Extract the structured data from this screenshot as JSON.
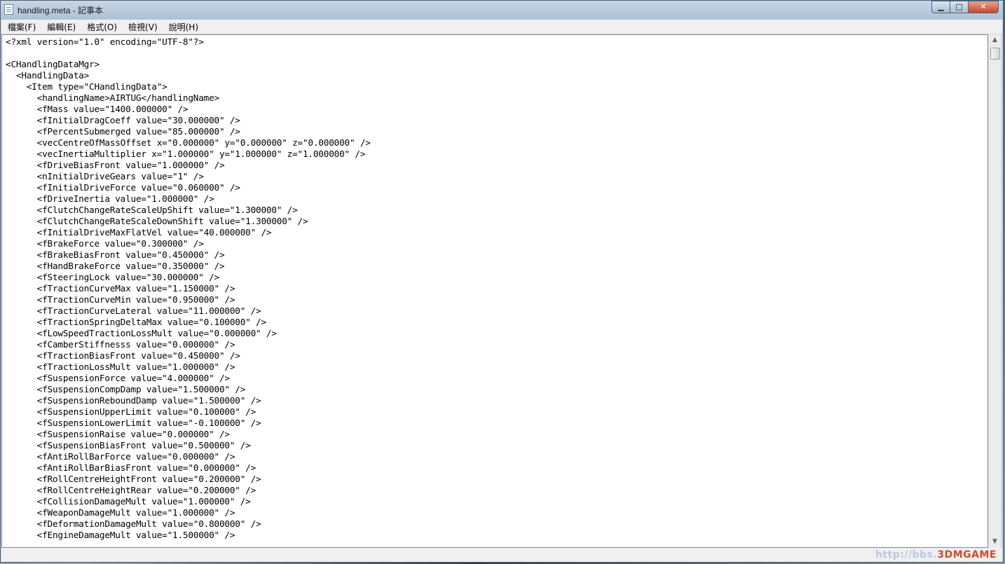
{
  "window": {
    "title": "handling.meta - 記事本",
    "buttons": {
      "minimize": "▁",
      "maximize": "□",
      "close": "✕"
    }
  },
  "menu": [
    "檔案(F)",
    "編輯(E)",
    "格式(O)",
    "檢視(V)",
    "說明(H)"
  ],
  "editor": {
    "lines": [
      "<?xml version=\"1.0\" encoding=\"UTF-8\"?>",
      "",
      "<CHandlingDataMgr>",
      "  <HandlingData>",
      "    <Item type=\"CHandlingData\">",
      "      <handlingName>AIRTUG</handlingName>",
      "      <fMass value=\"1400.000000\" />",
      "      <fInitialDragCoeff value=\"30.000000\" />",
      "      <fPercentSubmerged value=\"85.000000\" />",
      "      <vecCentreOfMassOffset x=\"0.000000\" y=\"0.000000\" z=\"0.000000\" />",
      "      <vecInertiaMultiplier x=\"1.000000\" y=\"1.000000\" z=\"1.000000\" />",
      "      <fDriveBiasFront value=\"1.000000\" />",
      "      <nInitialDriveGears value=\"1\" />",
      "      <fInitialDriveForce value=\"0.060000\" />",
      "      <fDriveInertia value=\"1.000000\" />",
      "      <fClutchChangeRateScaleUpShift value=\"1.300000\" />",
      "      <fClutchChangeRateScaleDownShift value=\"1.300000\" />",
      "      <fInitialDriveMaxFlatVel value=\"40.000000\" />",
      "      <fBrakeForce value=\"0.300000\" />",
      "      <fBrakeBiasFront value=\"0.450000\" />",
      "      <fHandBrakeForce value=\"0.350000\" />",
      "      <fSteeringLock value=\"30.000000\" />",
      "      <fTractionCurveMax value=\"1.150000\" />",
      "      <fTractionCurveMin value=\"0.950000\" />",
      "      <fTractionCurveLateral value=\"11.000000\" />",
      "      <fTractionSpringDeltaMax value=\"0.100000\" />",
      "      <fLowSpeedTractionLossMult value=\"0.000000\" />",
      "      <fCamberStiffnesss value=\"0.000000\" />",
      "      <fTractionBiasFront value=\"0.450000\" />",
      "      <fTractionLossMult value=\"1.000000\" />",
      "      <fSuspensionForce value=\"4.000000\" />",
      "      <fSuspensionCompDamp value=\"1.500000\" />",
      "      <fSuspensionReboundDamp value=\"1.500000\" />",
      "      <fSuspensionUpperLimit value=\"0.100000\" />",
      "      <fSuspensionLowerLimit value=\"-0.100000\" />",
      "      <fSuspensionRaise value=\"0.000000\" />",
      "      <fSuspensionBiasFront value=\"0.500000\" />",
      "      <fAntiRollBarForce value=\"0.000000\" />",
      "      <fAntiRollBarBiasFront value=\"0.000000\" />",
      "      <fRollCentreHeightFront value=\"0.200000\" />",
      "      <fRollCentreHeightRear value=\"0.200000\" />",
      "      <fCollisionDamageMult value=\"1.000000\" />",
      "      <fWeaponDamageMult value=\"1.000000\" />",
      "      <fDeformationDamageMult value=\"0.800000\" />",
      "      <fEngineDamageMult value=\"1.500000\" />"
    ]
  },
  "watermark": {
    "url": "http://bbs.",
    "brand": "3DMGAME"
  }
}
